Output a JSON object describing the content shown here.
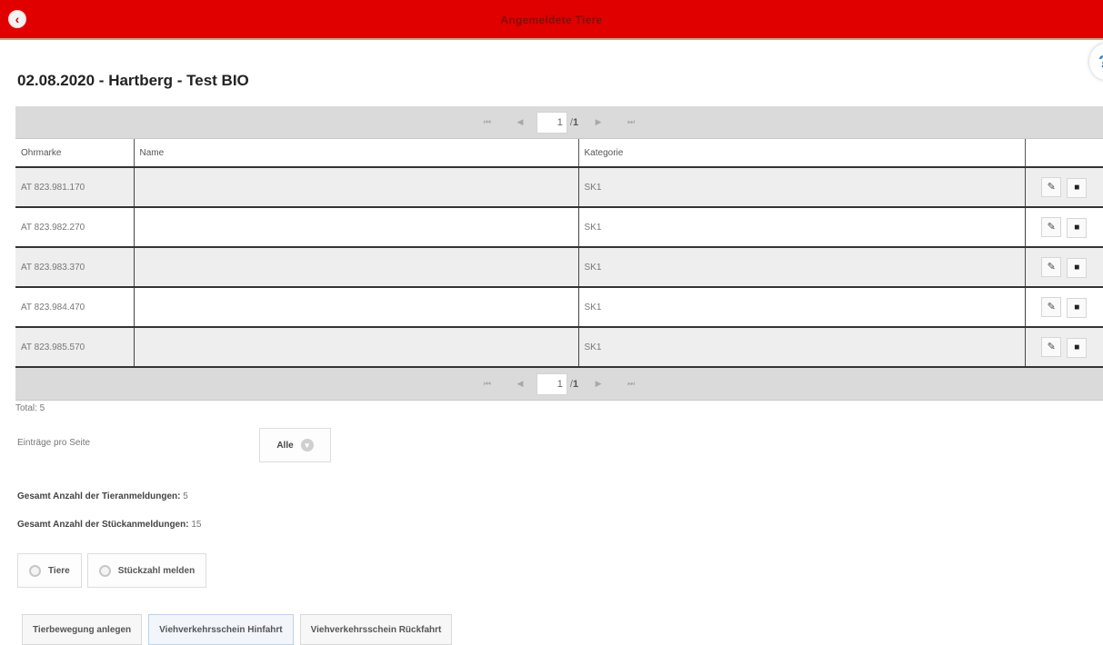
{
  "header": {
    "title": "Angemeldete Tiere",
    "back_icon": "back-arrow-icon",
    "accent_color": "#e00000"
  },
  "help_icon": "help-icon",
  "page": {
    "title": "02.08.2020 - Hartberg - Test BIO"
  },
  "pager": {
    "first": "⏮",
    "prev": "◀",
    "next": "▶",
    "last": "⏭",
    "current_page": "1",
    "separator": "/",
    "total_pages": "1"
  },
  "table": {
    "columns": [
      "Ohrmarke",
      "Name",
      "Kategorie",
      ""
    ],
    "rows": [
      {
        "ohrmarke": "AT 823.981.170",
        "name": "",
        "kategorie": "SK1"
      },
      {
        "ohrmarke": "AT 823.982.270",
        "name": "",
        "kategorie": "SK1"
      },
      {
        "ohrmarke": "AT 823.983.370",
        "name": "",
        "kategorie": "SK1"
      },
      {
        "ohrmarke": "AT 823.984.470",
        "name": "",
        "kategorie": "SK1"
      },
      {
        "ohrmarke": "AT 823.985.570",
        "name": "",
        "kategorie": "SK1"
      }
    ],
    "edit_icon": "edit-icon",
    "delete_icon": "trash-icon"
  },
  "total": "Total: 5",
  "entries_per_page": {
    "label": "Einträge pro Seite",
    "value": "Alle"
  },
  "stats": {
    "animal_label": "Gesamt Anzahl der Tieranmeldungen:",
    "animal_value": "5",
    "piece_label": "Gesamt Anzahl der Stückanmeldungen:",
    "piece_value": "15"
  },
  "mode": {
    "options": [
      "Tiere",
      "Stückzahl melden"
    ]
  },
  "actions": {
    "create_movement": "Tierbewegung anlegen",
    "outbound": "Viehverkehrsschein Hinfahrt",
    "return": "Viehverkehrsschein Rückfahrt"
  }
}
